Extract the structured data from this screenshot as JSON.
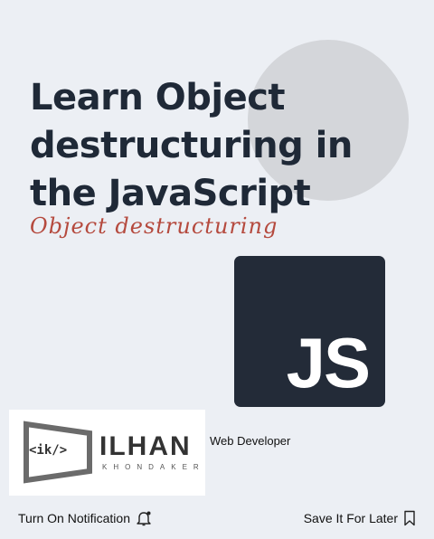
{
  "post": {
    "title": "Learn Object destructuring in the JavaScript",
    "subtitle": "Object destructuring",
    "logo_text": "JS"
  },
  "brand": {
    "tag": "<ik/>",
    "name": "ILHAN",
    "sub": "KHONDAKER",
    "role": "Web Developer"
  },
  "actions": {
    "notification_label": "Turn On Notification",
    "notification_icon": "bell-icon",
    "save_label": "Save It For Later",
    "save_icon": "bookmark-icon"
  },
  "colors": {
    "background": "#eceff4",
    "title": "#1f2937",
    "accent": "#b54a3e",
    "logo_bg": "#232b38"
  }
}
